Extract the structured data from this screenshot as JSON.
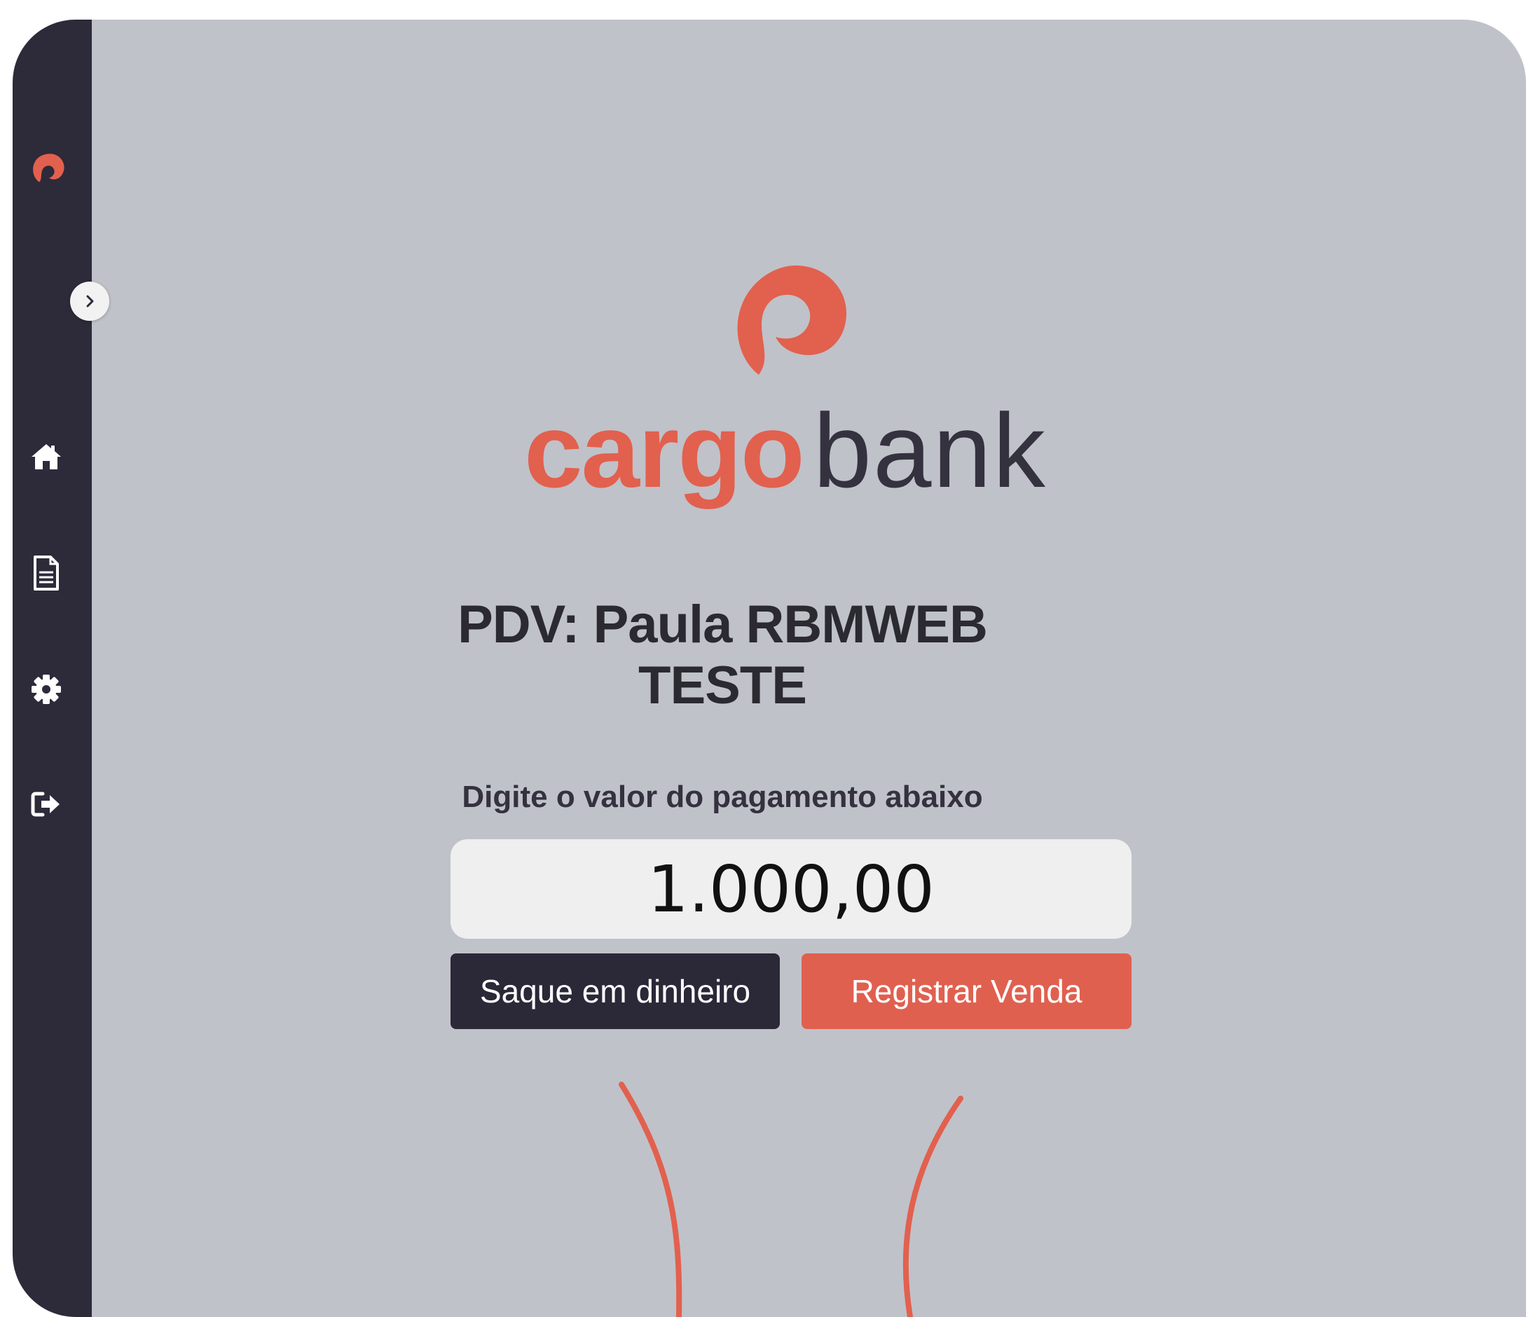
{
  "brand": {
    "word_primary": "cargo",
    "word_secondary": "bank",
    "accent_color": "#e2604e",
    "dark_color": "#2d2a3a"
  },
  "sidebar": {
    "items": [
      {
        "name": "home",
        "icon": "home-icon"
      },
      {
        "name": "documents",
        "icon": "document-icon"
      },
      {
        "name": "settings",
        "icon": "gear-icon"
      },
      {
        "name": "logout",
        "icon": "logout-icon"
      }
    ],
    "toggle_icon": "chevron-right-icon"
  },
  "main": {
    "pdv_title": "PDV: Paula RBMWEB TESTE",
    "prompt": "Digite o valor do pagamento abaixo",
    "amount_value": "1.000,00",
    "buttons": {
      "cash_withdrawal": "Saque em dinheiro",
      "register_sale": "Registrar Venda"
    }
  }
}
